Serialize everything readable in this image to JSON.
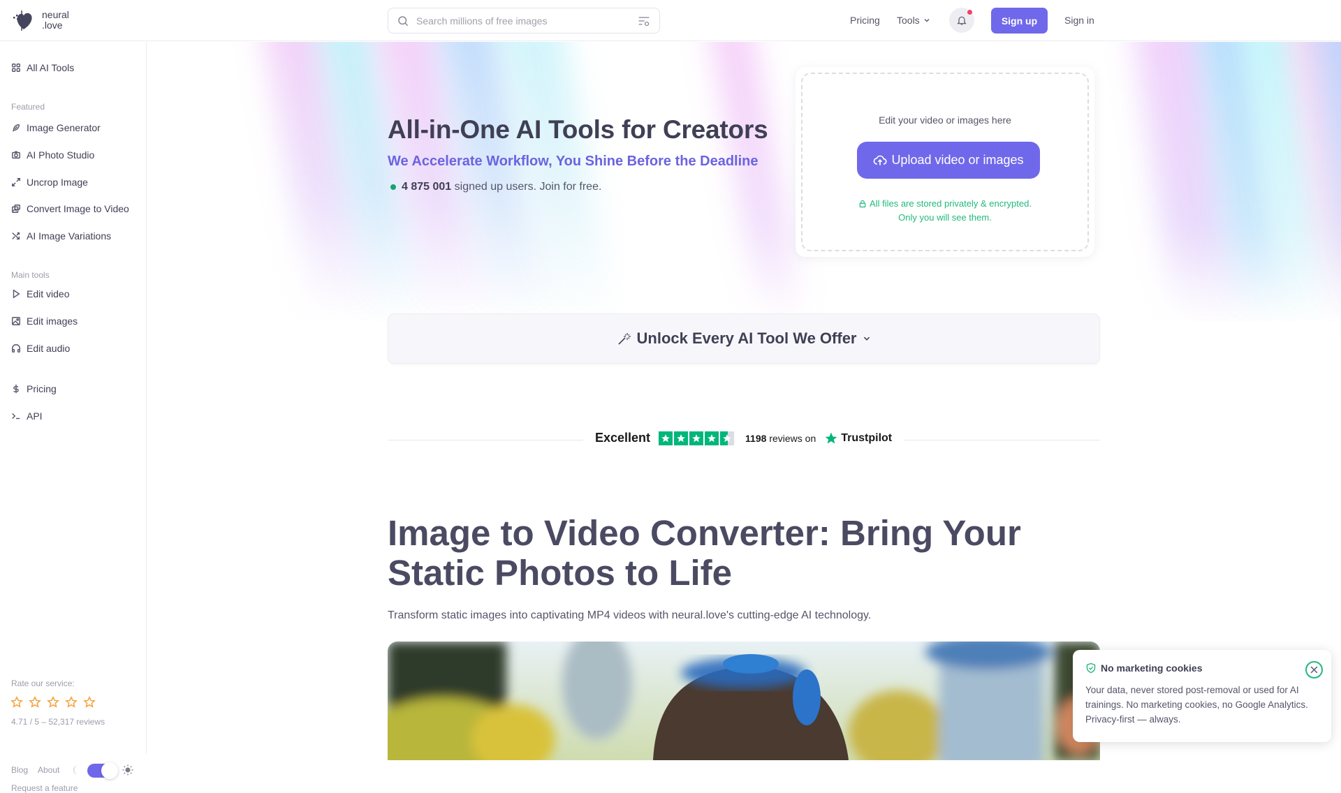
{
  "brand": {
    "name_line1": "neural",
    "name_line2": ".love"
  },
  "search": {
    "placeholder": "Search millions of free images",
    "value": ""
  },
  "nav": {
    "pricing": "Pricing",
    "tools": "Tools",
    "signup": "Sign up",
    "signin": "Sign in"
  },
  "sidebar": {
    "all_tools": "All AI Tools",
    "featured_heading": "Featured",
    "featured": [
      {
        "label": "Image Generator",
        "icon": "feather-icon"
      },
      {
        "label": "AI Photo Studio",
        "icon": "camera-icon"
      },
      {
        "label": "Uncrop Image",
        "icon": "expand-icon"
      },
      {
        "label": "Convert Image to Video",
        "icon": "image-video-icon"
      },
      {
        "label": "AI Image Variations",
        "icon": "shuffle-icon"
      }
    ],
    "main_heading": "Main tools",
    "main": [
      {
        "label": "Edit video",
        "icon": "play-icon"
      },
      {
        "label": "Edit images",
        "icon": "image-icon"
      },
      {
        "label": "Edit audio",
        "icon": "headphones-icon"
      }
    ],
    "extra": [
      {
        "label": "Pricing",
        "icon": "dollar-icon"
      },
      {
        "label": "API",
        "icon": "terminal-icon"
      }
    ],
    "rating": {
      "label": "Rate our service:",
      "stars": 5,
      "summary": "4.71 / 5 – 52,317 reviews"
    },
    "footer": {
      "blog": "Blog",
      "about": "About",
      "request": "Request a feature",
      "theme_toggle_on": true
    }
  },
  "hero": {
    "title": "All-in-One AI Tools for Creators",
    "subtitle": "We Accelerate Workflow, You Shine Before the Deadline",
    "user_count": "4 875 001",
    "user_text": "signed up users. Join for free."
  },
  "upload": {
    "label": "Edit your video or images here",
    "button": "Upload video or images",
    "privacy_line1": "All files are stored privately & encrypted.",
    "privacy_line2": "Only you will see them."
  },
  "unlock": {
    "label": "Unlock Every AI Tool We Offer"
  },
  "trustpilot": {
    "rating_word": "Excellent",
    "stars": 4.5,
    "review_count": "1198",
    "reviews_on": "reviews on",
    "brand": "Trustpilot"
  },
  "content": {
    "heading": "Image to Video Converter: Bring Your Static Photos to Life",
    "lead": "Transform static images into captivating MP4 videos with neural.love's cutting-edge AI technology."
  },
  "cookie": {
    "title": "No marketing cookies",
    "body": "Your data, never stored post-removal or used for AI trainings. No marketing cookies, no Google Analytics. Privacy-first — always."
  },
  "colors": {
    "accent": "#7068ea",
    "success": "#22b87e",
    "trustpilot": "#00b67a",
    "notify": "#f0426a",
    "star": "#f5a03a"
  }
}
